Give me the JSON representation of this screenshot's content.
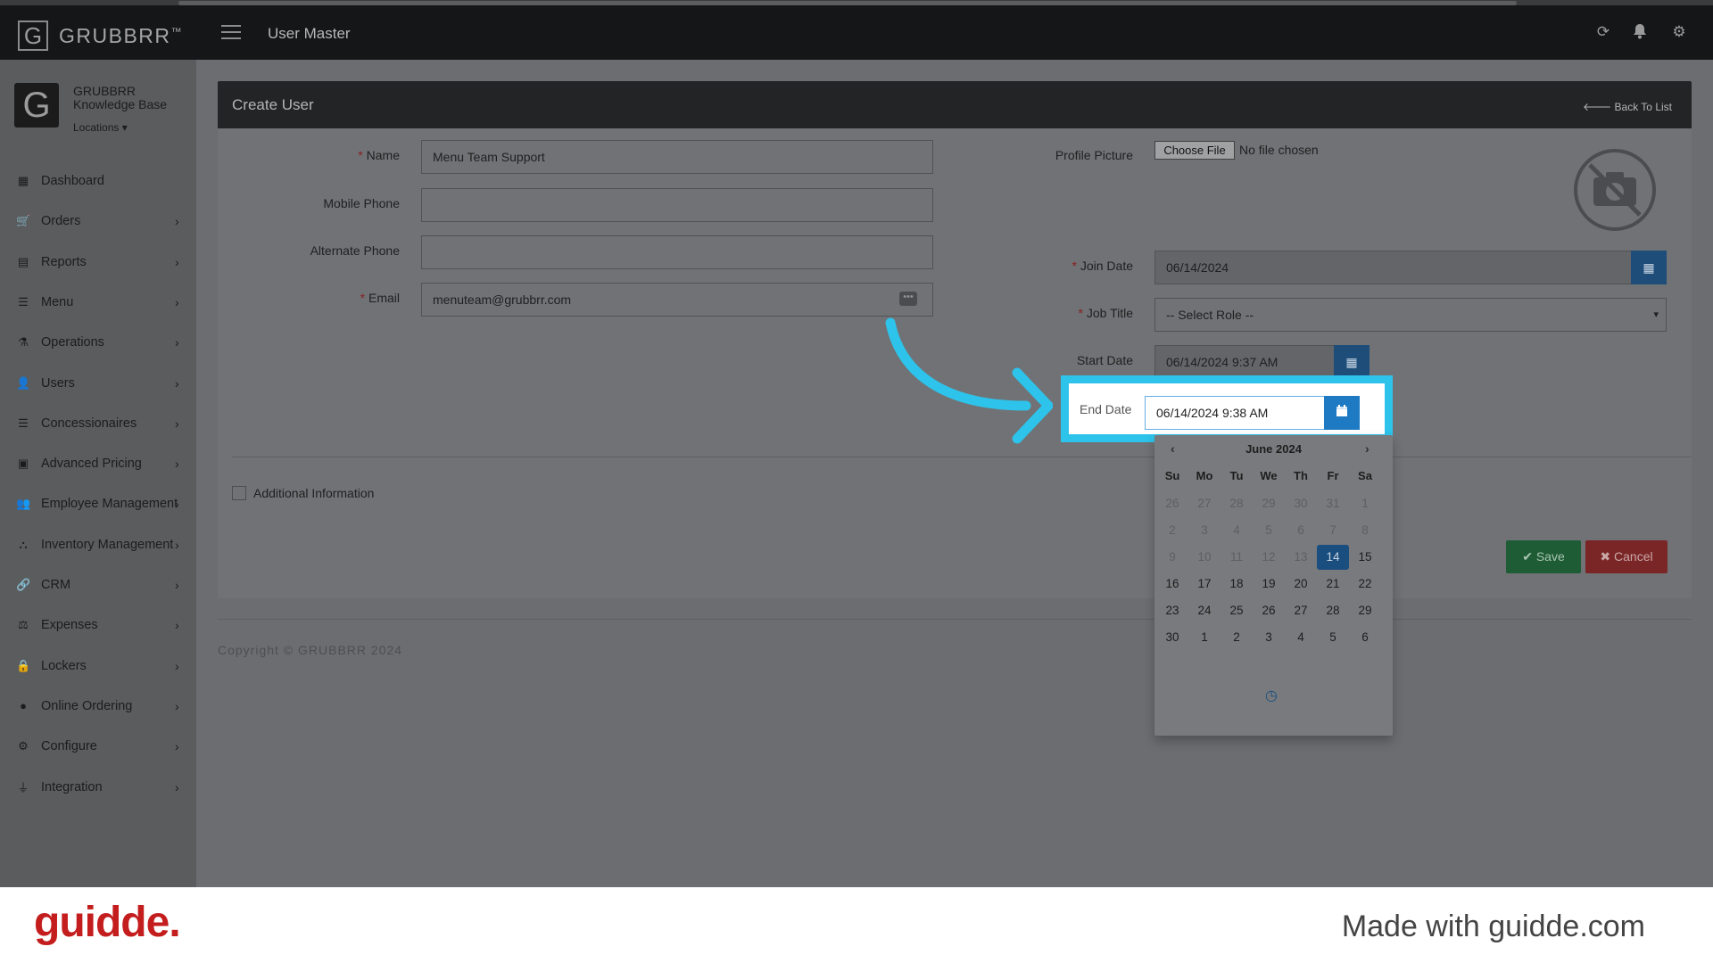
{
  "header": {
    "brand": "GRUBBRR",
    "trademark": "™",
    "page_title": "User Master",
    "icons": [
      "refresh-icon",
      "bell-icon",
      "gear-icon"
    ]
  },
  "sidebar": {
    "brand_name": "GRUBBRR Knowledge Base",
    "locations_label": "Locations",
    "items": [
      {
        "label": "Dashboard",
        "icon": "dashboard-icon",
        "has_submenu": false
      },
      {
        "label": "Orders",
        "icon": "cart-icon",
        "has_submenu": true
      },
      {
        "label": "Reports",
        "icon": "report-icon",
        "has_submenu": true
      },
      {
        "label": "Menu",
        "icon": "list-icon",
        "has_submenu": true
      },
      {
        "label": "Operations",
        "icon": "flask-icon",
        "has_submenu": true
      },
      {
        "label": "Users",
        "icon": "user-add-icon",
        "has_submenu": true
      },
      {
        "label": "Concessionaires",
        "icon": "list-icon",
        "has_submenu": true
      },
      {
        "label": "Advanced Pricing",
        "icon": "money-icon",
        "has_submenu": true
      },
      {
        "label": "Employee Management",
        "icon": "users-icon",
        "has_submenu": true
      },
      {
        "label": "Inventory Management",
        "icon": "sitemap-icon",
        "has_submenu": true
      },
      {
        "label": "CRM",
        "icon": "link-icon",
        "has_submenu": true
      },
      {
        "label": "Expenses",
        "icon": "scale-icon",
        "has_submenu": true
      },
      {
        "label": "Lockers",
        "icon": "lock-icon",
        "has_submenu": true
      },
      {
        "label": "Online Ordering",
        "icon": "globe-icon",
        "has_submenu": true
      },
      {
        "label": "Configure",
        "icon": "cog-icon",
        "has_submenu": true
      },
      {
        "label": "Integration",
        "icon": "plug-icon",
        "has_submenu": true
      }
    ]
  },
  "form": {
    "title": "Create User",
    "back_label": "Back To List",
    "name_label": "Name",
    "name_value": "Menu Team Support",
    "mobile_label": "Mobile Phone",
    "mobile_value": "",
    "alt_phone_label": "Alternate Phone",
    "alt_phone_value": "",
    "email_label": "Email",
    "email_value": "menuteam@grubbrr.com",
    "profile_label": "Profile Picture",
    "choose_file_label": "Choose File",
    "no_file_label": "No file chosen",
    "join_date_label": "Join Date",
    "join_date_value": "06/14/2024",
    "job_title_label": "Job Title",
    "job_title_value": "-- Select Role --",
    "start_date_label": "Start Date",
    "start_date_value": "06/14/2024 9:37 AM",
    "end_date_label": "End Date",
    "end_date_value": "06/14/2024 9:38 AM",
    "additional_info_label": "Additional Information",
    "save_label": "Save",
    "cancel_label": "Cancel",
    "required_mark": "*"
  },
  "datepicker": {
    "month_label": "June 2024",
    "weekdays": [
      "Su",
      "Mo",
      "Tu",
      "We",
      "Th",
      "Fr",
      "Sa"
    ],
    "weeks": [
      [
        "26",
        "27",
        "28",
        "29",
        "30",
        "31",
        "1"
      ],
      [
        "2",
        "3",
        "4",
        "5",
        "6",
        "7",
        "8"
      ],
      [
        "9",
        "10",
        "11",
        "12",
        "13",
        "14",
        "15"
      ],
      [
        "16",
        "17",
        "18",
        "19",
        "20",
        "21",
        "22"
      ],
      [
        "23",
        "24",
        "25",
        "26",
        "27",
        "28",
        "29"
      ],
      [
        "30",
        "1",
        "2",
        "3",
        "4",
        "5",
        "6"
      ]
    ],
    "selected_day": "14",
    "disabled_before_index": 19
  },
  "footer": {
    "copyright": "Copyright © GRUBBRR 2024",
    "guidde_logo": "guidde.",
    "made_with": "Made with guidde.com"
  },
  "colors": {
    "highlight": "#2ec3ea",
    "primary_button": "#1e7ac2",
    "save": "#1d5c34",
    "cancel": "#7b2626",
    "guidde_red": "#c41d1d"
  }
}
